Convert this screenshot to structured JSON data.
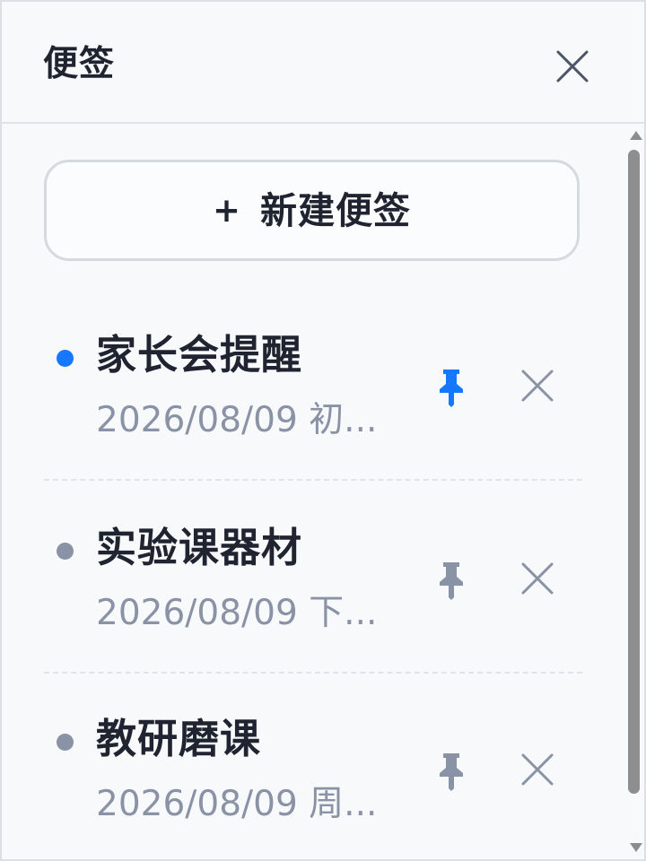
{
  "header": {
    "title": "便签",
    "close_icon": "close-icon"
  },
  "new_note": {
    "plus": "+",
    "label": "新建便签"
  },
  "notes": [
    {
      "title": "家长会提醒",
      "preview": "2026/08/09 初...",
      "status_color": "#1677ff",
      "pinned": true,
      "pin_color": "#1677ff",
      "pin_icon": "pin-icon",
      "delete_icon": "close-icon"
    },
    {
      "title": "实验课器材",
      "preview": "2026/08/09 下...",
      "status_color": "#8a93a5",
      "pinned": false,
      "pin_color": "#8a93a5",
      "pin_icon": "pin-icon",
      "delete_icon": "close-icon"
    },
    {
      "title": "教研磨课",
      "preview": "2026/08/09 周...",
      "status_color": "#8a93a5",
      "pinned": false,
      "pin_color": "#8a93a5",
      "pin_icon": "pin-icon",
      "delete_icon": "close-icon"
    }
  ],
  "colors": {
    "text_primary": "#1f2430",
    "text_secondary": "#8a93a5",
    "accent": "#1677ff",
    "border": "#d6d9de",
    "background": "#f8f9fb",
    "scrollbar": "#8e8e8e"
  }
}
